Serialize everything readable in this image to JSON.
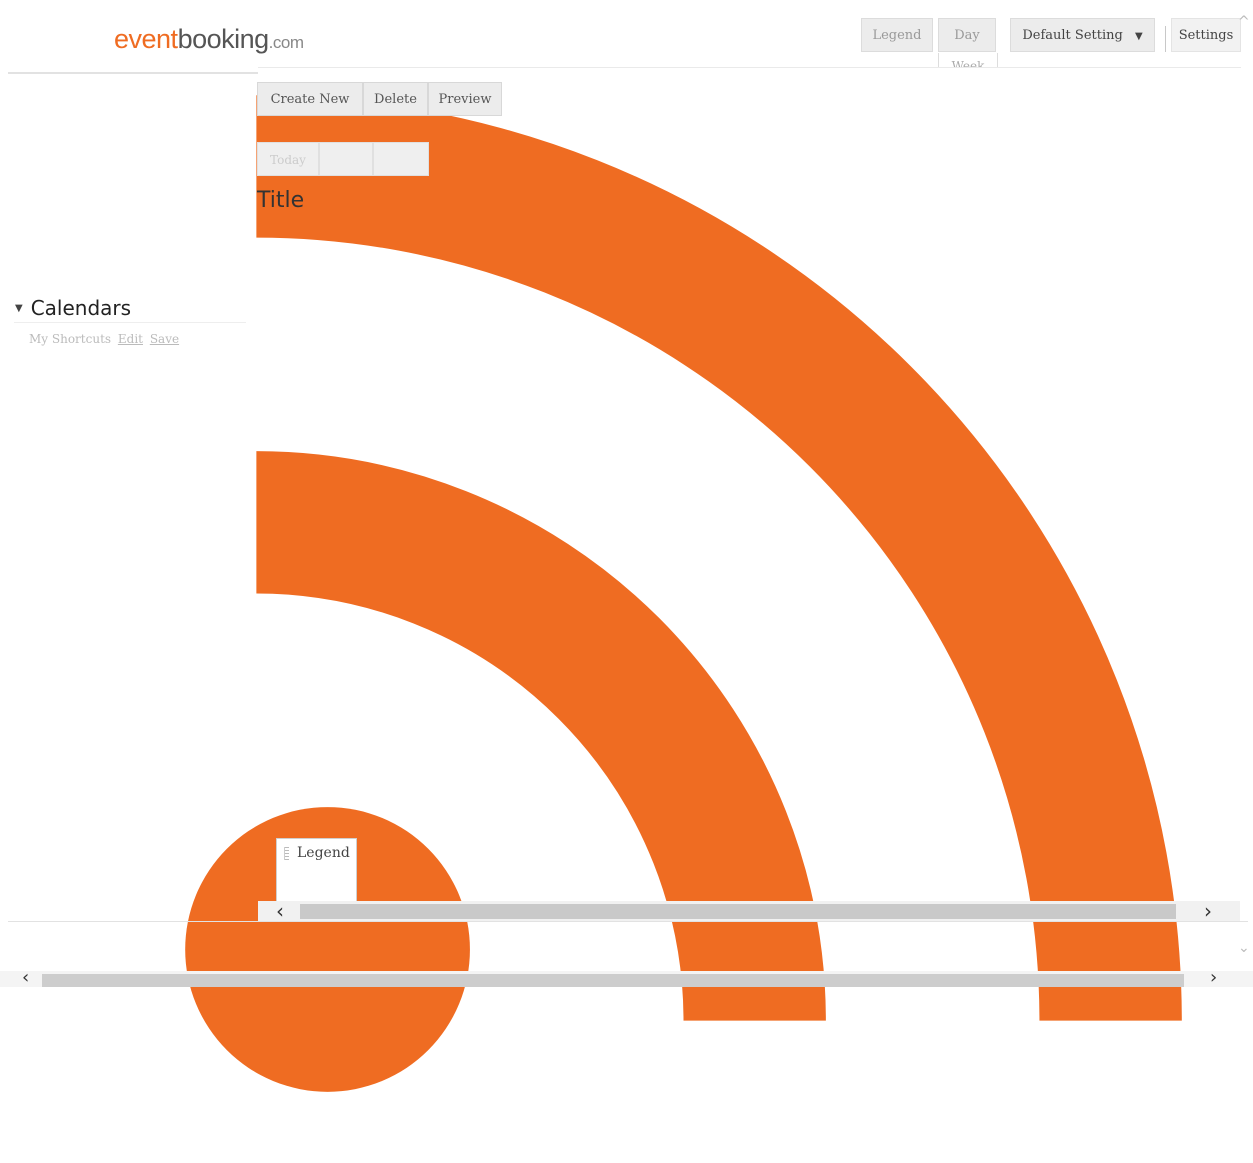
{
  "logo": {
    "part1": "event",
    "part2": "booking",
    "part3": ".com"
  },
  "toolbar": {
    "legend": "Legend",
    "day": "Day",
    "week": "Week",
    "default_setting": "Default Setting",
    "dropdown_arrow": "▼",
    "settings": "Settings"
  },
  "actions": {
    "create_new": "Create New",
    "delete": "Delete",
    "preview": "Preview"
  },
  "nav": {
    "today": "Today",
    "prev": "",
    "next": ""
  },
  "main": {
    "title": "Title"
  },
  "sidebar": {
    "calendars_label": "Calendars",
    "collapse_glyph": "▼",
    "shortcuts_label": "My Shortcuts",
    "edit_link": "Edit",
    "save_link": "Save"
  },
  "legend_box": {
    "label": "Legend"
  },
  "scroll": {
    "left": "‹",
    "right": "›",
    "up": "^",
    "down": "⌄"
  },
  "colors": {
    "brand_orange": "#ef6c22",
    "brand_gray": "#555555"
  }
}
